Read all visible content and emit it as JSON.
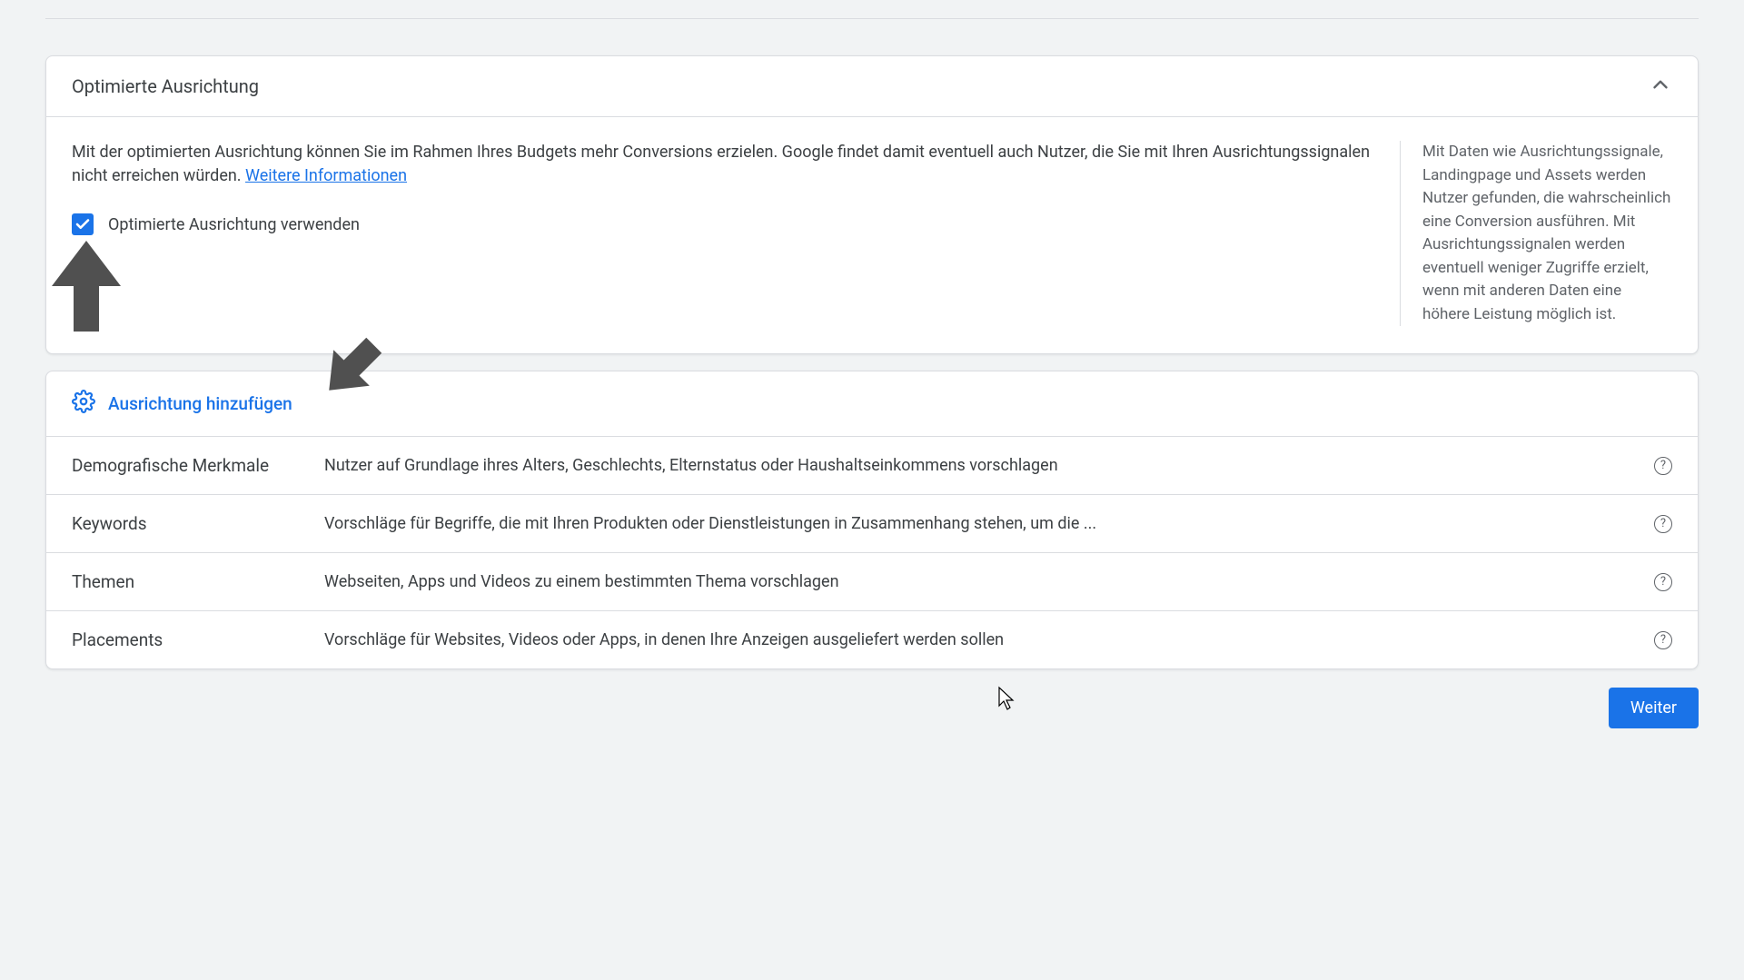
{
  "card1": {
    "title": "Optimierte Ausrichtung",
    "description_part1": "Mit der optimierten Ausrichtung können Sie im Rahmen Ihres Budgets mehr Conversions erzielen. Google findet damit eventuell auch Nutzer, die Sie mit Ihren Ausrichtungssignalen nicht erreichen würden. ",
    "learn_more": "Weitere Informationen",
    "checkbox_label": "Optimierte Ausrichtung verwenden",
    "side_text": "Mit Daten wie Ausrichtungssignale, Landingpage und Assets werden Nutzer gefunden, die wahrscheinlich eine Conversion ausführen. Mit Ausrichtungssignalen werden eventuell weniger Zugriffe erzielt, wenn mit anderen Daten eine höhere Leistung möglich ist."
  },
  "add_targeting": {
    "header": "Ausrichtung hinzufügen",
    "options": [
      {
        "label": "Demografische Merkmale",
        "desc": "Nutzer auf Grundlage ihres Alters, Geschlechts, Elternstatus oder Haushaltseinkommens vorschlagen"
      },
      {
        "label": "Keywords",
        "desc": "Vorschläge für Begriffe, die mit Ihren Produkten oder Dienstleistungen in Zusammenhang stehen, um die ..."
      },
      {
        "label": "Themen",
        "desc": "Webseiten, Apps und Videos zu einem bestimmten Thema vorschlagen"
      },
      {
        "label": "Placements",
        "desc": "Vorschläge für Websites, Videos oder Apps, in denen Ihre Anzeigen ausgeliefert werden sollen"
      }
    ]
  },
  "footer": {
    "continue": "Weiter"
  }
}
